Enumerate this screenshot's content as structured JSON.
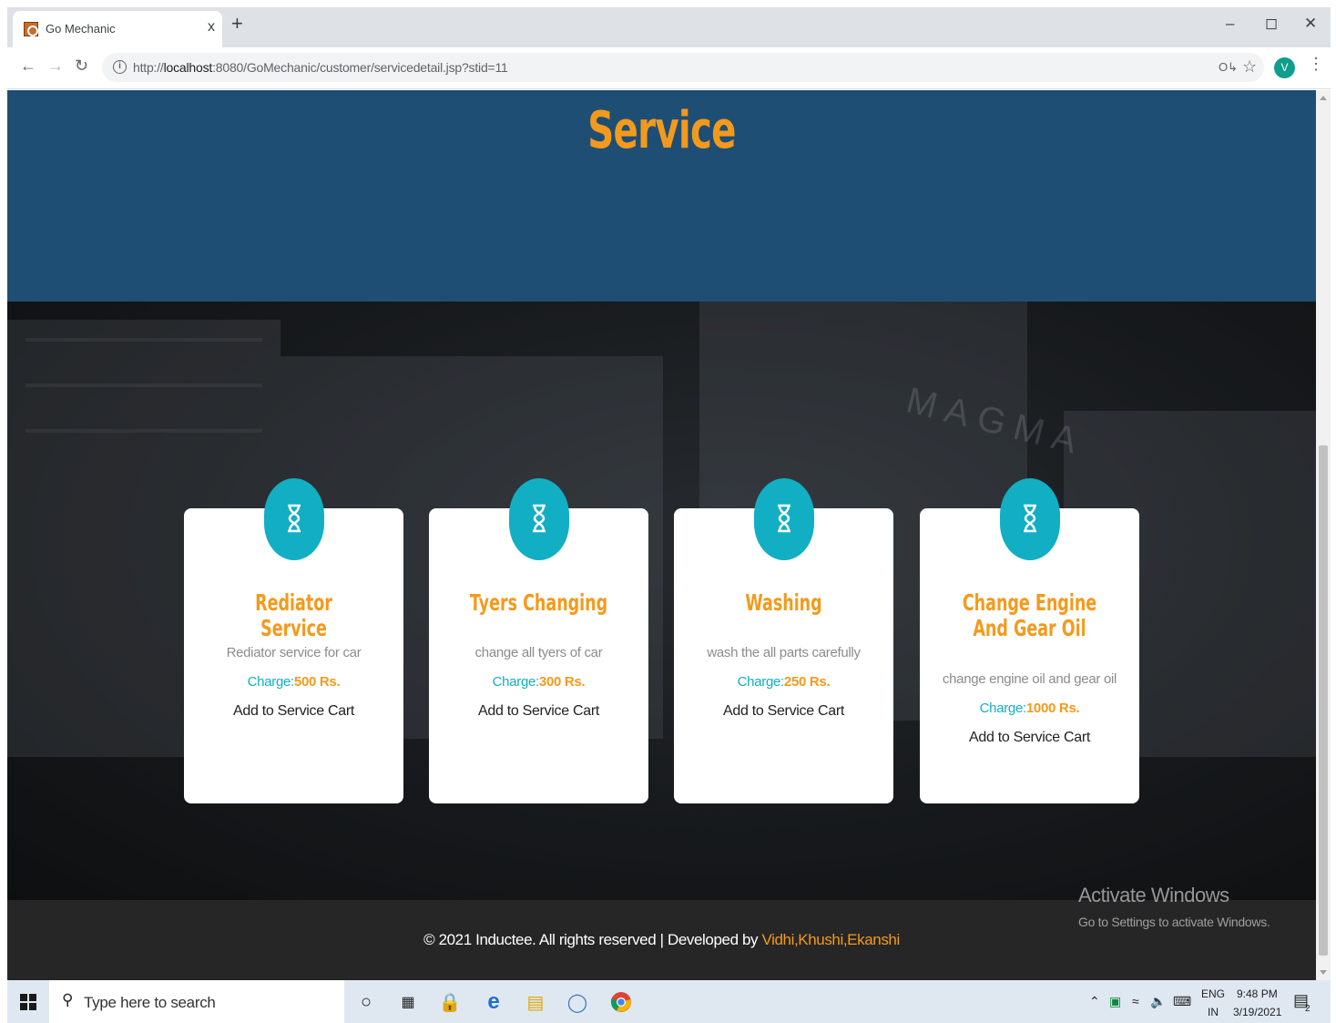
{
  "browser": {
    "tab_title": "Go Mechanic",
    "tab_close": "x",
    "new_tab": "+",
    "url_prefix": "http://",
    "url_host": "localhost",
    "url_rest": ":8080/GoMechanic/customer/servicedetail.jsp?stid=11",
    "profile_initial": "V"
  },
  "page": {
    "title": "Service",
    "brand_watermark": "MAGMA"
  },
  "services": [
    {
      "title": "Rediator Service",
      "desc": "Rediator service for car",
      "charge_label": "Charge:",
      "charge_value": "500 Rs.",
      "cart": "Add to Service Cart"
    },
    {
      "title": "Tyers Changing",
      "desc": "change all tyers of car",
      "charge_label": "Charge:",
      "charge_value": "300 Rs.",
      "cart": "Add to Service Cart"
    },
    {
      "title": "Washing",
      "desc": "wash the all parts carefully",
      "charge_label": "Charge:",
      "charge_value": "250 Rs.",
      "cart": "Add to Service Cart"
    },
    {
      "title": "Change Engine And Gear Oil",
      "desc": "change engine oil and gear oil",
      "charge_label": "Charge:",
      "charge_value": "1000 Rs.",
      "cart": "Add to Service Cart"
    }
  ],
  "footer": {
    "text": "© 2021 Inductee. All rights reserved | Developed by ",
    "developers": "Vidhi,Khushi,Ekanshi"
  },
  "activation": {
    "title": "Activate Windows",
    "subtitle": "Go to Settings to activate Windows."
  },
  "taskbar": {
    "search_placeholder": "Type here to search",
    "lang_top": "ENG",
    "lang_bottom": "IN",
    "time": "9:48 PM",
    "date": "3/19/2021",
    "notification_count": "2"
  },
  "colors": {
    "accent_orange": "#f39a1c",
    "accent_teal": "#12aec4",
    "banner_blue": "#1f4e75"
  }
}
